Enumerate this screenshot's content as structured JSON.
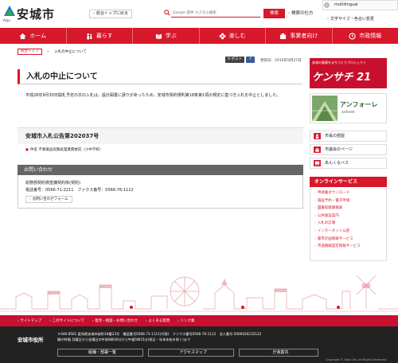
{
  "colors": {
    "accent": "#d7172a",
    "dark": "#222222",
    "contact_head": "#666666"
  },
  "header": {
    "logo_text": "安城市",
    "logo_sub": "Anjo",
    "top_link": "総合トップに戻る",
    "search_placeholder": "Google 提供 カスタム検索",
    "search_button": "検索",
    "search_how": "検索の仕方",
    "multilingual": "multilingual",
    "font_link": "文字サイズ・色合い変更"
  },
  "nav": {
    "items": [
      {
        "label": "ホーム",
        "icon": "home-icon"
      },
      {
        "label": "暮らす",
        "icon": "family-icon"
      },
      {
        "label": "学ぶ",
        "icon": "book-icon"
      },
      {
        "label": "楽しむ",
        "icon": "flower-icon"
      },
      {
        "label": "事業者向け",
        "icon": "building-icon"
      },
      {
        "label": "市政情報",
        "icon": "cityhall-icon"
      }
    ]
  },
  "breadcrumb": {
    "home": "総合トップ",
    "current": "入札の中止について"
  },
  "share": {
    "tweet": "ポスト",
    "fb": "f",
    "updated": "更新日：2016年9月27日"
  },
  "page": {
    "title": "入札の中止について",
    "body": "平成28年9月30日開札予定の次の入札は，設計図書に誤りがあったため，安城市契約規則第18条第1項の規定に基づき入札を中止としました。",
    "notice_title": "安城市入札公告第202037号",
    "notice_item": "件名 不要薬品収集処理業務委託（小中学校）"
  },
  "contact": {
    "head": "お問い合わせ",
    "dept": "総務部契約検査課契約係(契約)",
    "tel": "電話番号：0566-71-2211　ファクス番号：0566-76-1112",
    "form": "お問い合わせフォーム"
  },
  "sidebar": {
    "banner1_small": "安城の健康をまちづくりプロジェクト",
    "banner1_big": "ケンサチ 21",
    "banner2_title": "アンフォーレ",
    "banner2_sub": "anforet",
    "links": [
      {
        "label": "市長の部屋",
        "icon": "person-icon"
      },
      {
        "label": "市議会のページ",
        "icon": "assembly-icon"
      },
      {
        "label": "あんくるバス",
        "icon": "bus-icon"
      }
    ],
    "online_head": "オンラインサービス",
    "online_items": [
      "申請書ダウンロード",
      "施設予約・電子申請",
      "図書館蔵書検索",
      "公共施設案内",
      "入札の広場",
      "インターネット公売",
      "都市計画情報サービス",
      "市道路線認定情報サービス"
    ]
  },
  "footer": {
    "links": [
      "サイトマップ",
      "このサイトについて",
      "意見・相談・お問い合わせ",
      "よくある質問",
      "リンク集"
    ],
    "name": "安城市役所",
    "address": "〒446-8501 愛知県安城市桜町18番23号　電話番号0566-71-1111(代表)　ファクス番号0566-76-1112　法人番号:5000020232122",
    "hours": "開庁時間 月曜日から金曜日の午前8時30分から午後5時15分(祝日・年末年始を除く)まで",
    "buttons": [
      "組織・部署一覧",
      "アクセスマップ",
      "庁舎案内"
    ],
    "copyright": "Copyright © Anjo City. All Rights Reserved."
  }
}
